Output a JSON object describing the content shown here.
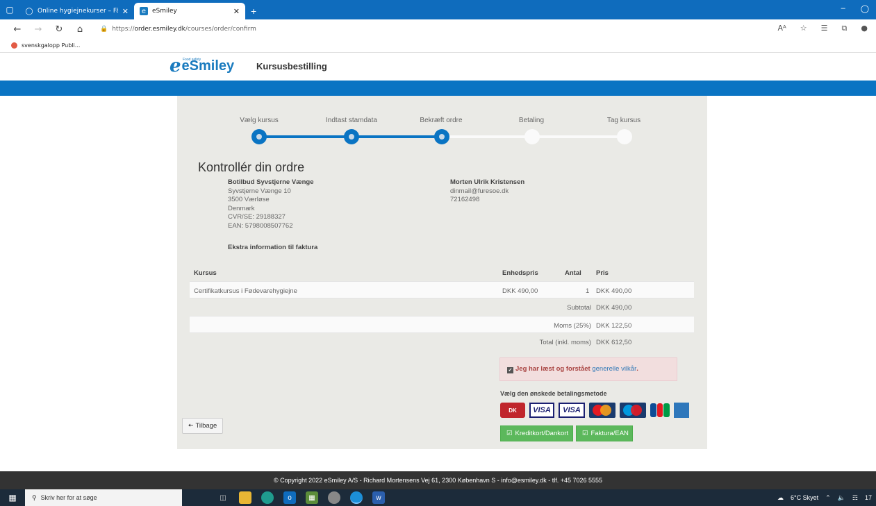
{
  "browser": {
    "tabs": [
      {
        "title": "Online hygiejnekurser – Få certifi",
        "active": false
      },
      {
        "title": "eSmiley",
        "active": true
      }
    ],
    "new_tab": "+",
    "url_prefix": "https://",
    "url_domain": "order.esmiley.dk",
    "url_path": "/courses/order/confirm",
    "reader_mode": "Aᴬ",
    "favorites": [
      {
        "label": "svenskgalopp Publi..."
      }
    ]
  },
  "site": {
    "logo_small": "Food safety",
    "logo_word": "eSmiley",
    "title": "Kursusbestilling"
  },
  "steps": [
    {
      "label": "Vælg kursus",
      "done": true
    },
    {
      "label": "Indtast stamdata",
      "done": true
    },
    {
      "label": "Bekræft ordre",
      "done": true
    },
    {
      "label": "Betaling",
      "done": false
    },
    {
      "label": "Tag kursus",
      "done": false
    }
  ],
  "order": {
    "heading": "Kontrollér din ordre",
    "billing": {
      "name": "Botilbud Syvstjerne Vænge",
      "street": "Syvstjerne Vænge 10",
      "city": "3500 Værløse",
      "country": "Denmark",
      "cvr": "CVR/SE: 29188327",
      "ean": "EAN: 5798008507762"
    },
    "contact": {
      "name": "Morten Ulrik Kristensen",
      "email": "dinmail@furesoe.dk",
      "phone": "72162498"
    },
    "extra_info_label": "Ekstra information til faktura",
    "table": {
      "headers": {
        "course": "Kursus",
        "unit_price": "Enhedspris",
        "qty": "Antal",
        "price": "Pris"
      },
      "rows": [
        {
          "course": "Certifikatkursus i Fødevarehygiejne",
          "unit_price": "DKK 490,00",
          "qty": "1",
          "price": "DKK 490,00"
        }
      ],
      "subtotal_label": "Subtotal",
      "subtotal_value": "DKK 490,00",
      "vat_label": "Moms (25%)",
      "vat_value": "DKK 122,50",
      "total_label": "Total (inkl. moms)",
      "total_value": "DKK 612,50"
    },
    "terms": {
      "text": "Jeg har læst og forstået",
      "link": "generelle vilkår",
      "suffix": ".",
      "checked": true
    },
    "payment_label": "Vælg den ønskede betalingsmetode",
    "cards": [
      "DK",
      "VISA",
      "VISA",
      "MasterCard",
      "Maestro",
      "JCB",
      "AMEX"
    ],
    "btn_card": "Kreditkort/Dankort",
    "btn_invoice": "Faktura/EAN",
    "btn_back": "Tilbage"
  },
  "footer": {
    "text": "© Copyright 2022 eSmiley A/S - Richard Mortensens Vej 61, 2300 København S - info@esmiley.dk - tlf. +45 7026 5555"
  },
  "taskbar": {
    "search_placeholder": "Skriv her for at søge",
    "weather": "6°C Skyet",
    "clock": "17"
  },
  "colors": {
    "brand_blue": "#0a74c3",
    "success_green": "#5cb85c",
    "alert_bg": "#f2dede",
    "panel_bg": "#eaeae6"
  }
}
